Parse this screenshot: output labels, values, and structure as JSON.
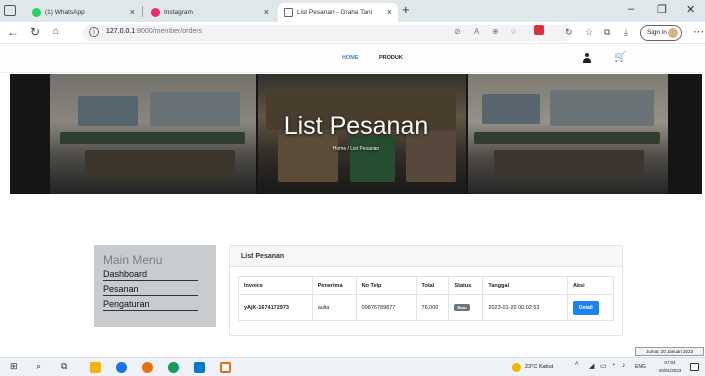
{
  "browser": {
    "tabs": [
      {
        "label": "(1) WhatsApp",
        "favicon_color": "#25d366"
      },
      {
        "label": "Instagram",
        "favicon_color": "#e1306c"
      },
      {
        "label": "List Pesanan - Graha Tani",
        "favicon_color": "#ffffff"
      }
    ],
    "url": {
      "host": "127.0.0.1",
      "path": ":8000/member/orders"
    },
    "sign_in_label": "Sign in",
    "new_tab": "+",
    "controls": {
      "minimize": "–",
      "maximize": "❐",
      "close": "✕"
    }
  },
  "site": {
    "nav": [
      {
        "label": "HOME",
        "active": true
      },
      {
        "label": "PRODUK",
        "active": false
      }
    ]
  },
  "hero": {
    "title": "List Pesanan",
    "breadcrumb": "Home  /  List Pesanan"
  },
  "sidebar": {
    "title": "Main Menu",
    "items": [
      "Dashboard",
      "Pesanan",
      "Pengaturan"
    ]
  },
  "orders": {
    "card_title": "List Pesanan",
    "columns": [
      "Invoice",
      "Penerima",
      "No Telp",
      "Total",
      "Status",
      "Tanggal",
      "Aksi"
    ],
    "rows": [
      {
        "invoice": "yAjK-1674172973",
        "penerima": "aulia",
        "no_telp": "09876789877",
        "total": "76,000",
        "status": "Baru",
        "tanggal": "2023-01-20 00:02:53",
        "aksi": "Detail"
      }
    ]
  },
  "tooltip": "Jumat, 20 Januari 2023",
  "taskbar": {
    "weather": "23°C  Kabut",
    "lang": "ENG",
    "time": "07.04",
    "date": "20/01/2023",
    "icon_colors": [
      "#f5b400",
      "#1a73e8",
      "#e8710a",
      "#0f9d58",
      "#007acc",
      "#e8710a"
    ]
  }
}
